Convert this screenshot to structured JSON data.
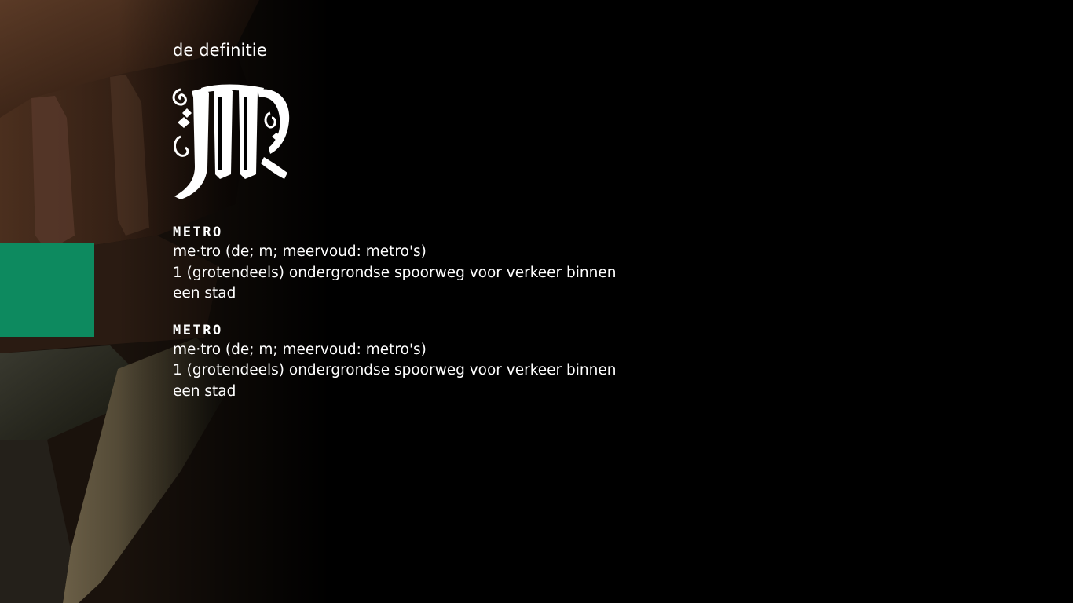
{
  "page": {
    "label": "de definitie",
    "drop_cap_letter": "M"
  },
  "colors": {
    "background": "#000000",
    "accent_tile": "#0d8a5f",
    "text": "#ffffff"
  },
  "entries": [
    {
      "headword": "METRO",
      "pronunciation": "me·tro (de; m; meervoud: metro's)",
      "definition": "1 (grotendeels) ondergrondse spoorweg voor verkeer binnen een stad"
    },
    {
      "headword": "METRO",
      "pronunciation": "me·tro (de; m; meervoud: metro's)",
      "definition": "1 (grotendeels) ondergrondse spoorweg voor verkeer binnen een stad"
    }
  ]
}
